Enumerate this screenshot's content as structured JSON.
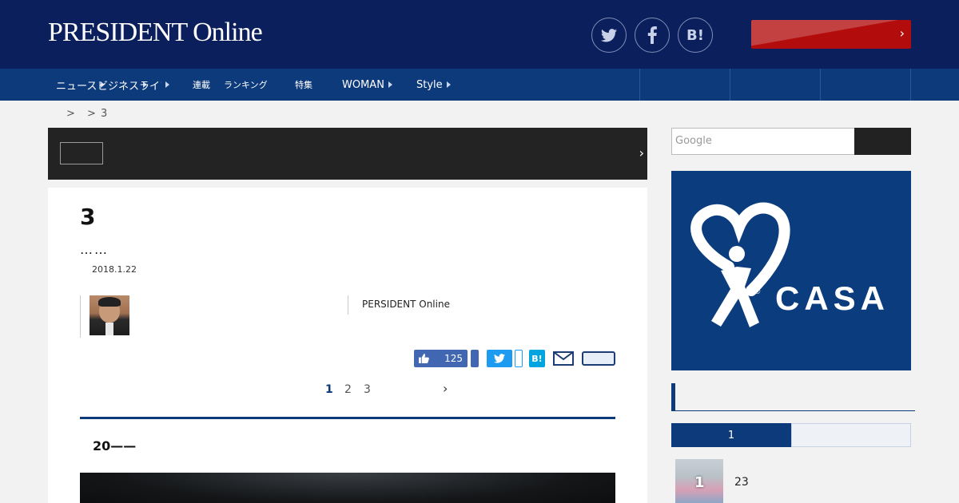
{
  "header": {
    "logo": "PRESIDENT Online",
    "social": {
      "twitter": "twitter-icon",
      "facebook": "facebook-icon",
      "hatena": "B!"
    },
    "cta_color": "#b30c0c"
  },
  "nav": {
    "items": [
      {
        "label": "ニュース"
      },
      {
        "label": "ビジネス"
      },
      {
        "label": "ライフスタイル"
      },
      {
        "label": "連載"
      },
      {
        "label": "ランキング"
      },
      {
        "label": "特集"
      },
      {
        "label": "WOMAN"
      },
      {
        "label": "Style"
      }
    ]
  },
  "breadcrumb": {
    "sep1": ">",
    "sep2": ">",
    "current": "3"
  },
  "article": {
    "title": "3",
    "subtitle": "……",
    "date": "2018.1.22",
    "publisher": "PERSIDENT Online",
    "like_count": "125",
    "hatena": "B!",
    "pages": [
      "1",
      "2",
      "3"
    ],
    "section_heading": "20——"
  },
  "sidebar": {
    "search_placeholder": "Google",
    "ad": {
      "brand": "CASA",
      "mark": "®"
    },
    "ranking_tab": "1",
    "ranking_item": {
      "num": "1",
      "text": "23"
    }
  },
  "colors": {
    "navy": "#0b1f5c",
    "nav": "#0d3a7b",
    "accent": "#b30c0c"
  }
}
